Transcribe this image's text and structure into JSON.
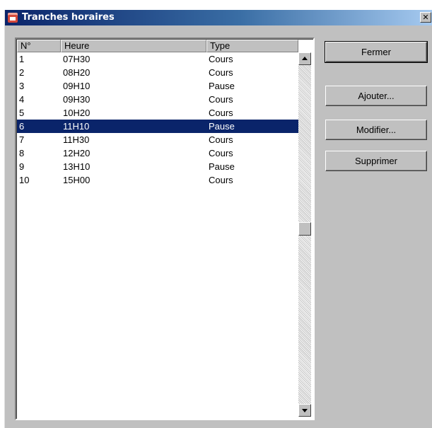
{
  "window": {
    "title": "Tranches horaires",
    "close_label": "✕"
  },
  "list": {
    "columns": [
      "N°",
      "Heure",
      "Type"
    ],
    "rows": [
      {
        "num": "1",
        "heure": "07H30",
        "type": "Cours"
      },
      {
        "num": "2",
        "heure": "08H20",
        "type": "Cours"
      },
      {
        "num": "3",
        "heure": "09H10",
        "type": "Pause"
      },
      {
        "num": "4",
        "heure": "09H30",
        "type": "Cours"
      },
      {
        "num": "5",
        "heure": "10H20",
        "type": "Cours"
      },
      {
        "num": "6",
        "heure": "11H10",
        "type": "Pause"
      },
      {
        "num": "7",
        "heure": "11H30",
        "type": "Cours"
      },
      {
        "num": "8",
        "heure": "12H20",
        "type": "Cours"
      },
      {
        "num": "9",
        "heure": "13H10",
        "type": "Pause"
      },
      {
        "num": "10",
        "heure": "15H00",
        "type": "Cours"
      }
    ],
    "selected_index": 5
  },
  "buttons": {
    "fermer": "Fermer",
    "ajouter": "Ajouter...",
    "modifier": "Modifier...",
    "supprimer": "Supprimer"
  },
  "colors": {
    "selection": "#0a246a",
    "titlebar": "#0a246a",
    "face": "#c0c0c0"
  },
  "icons": [
    "app-calendar-icon",
    "close-icon",
    "scroll-up-arrow-icon",
    "scroll-down-arrow-icon"
  ]
}
